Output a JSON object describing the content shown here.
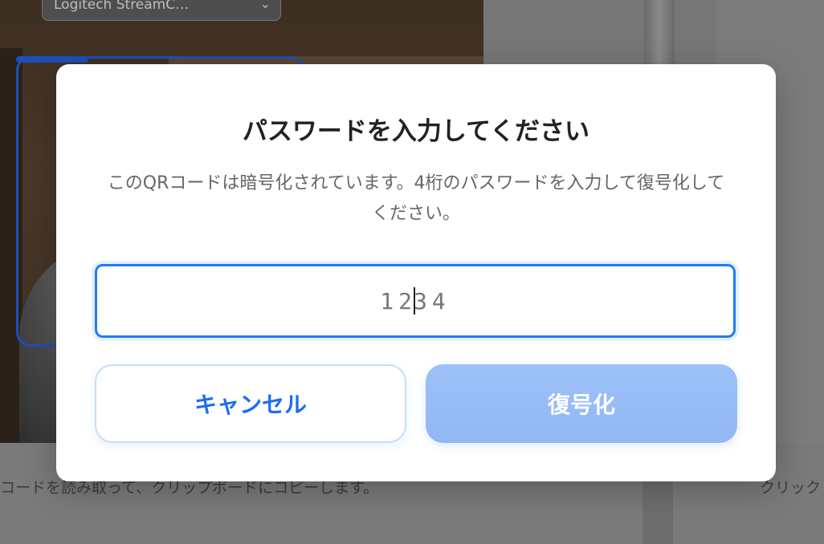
{
  "background": {
    "camera_select_label": "Logitech StreamC…",
    "footer_text_left": "コードを読み取って、クリップボードにコピーします。",
    "footer_text_right": "クリック"
  },
  "dialog": {
    "title": "パスワードを入力してください",
    "description": "このQRコードは暗号化されています。4桁のパスワードを入力して復号化してください。",
    "password_value_before_caret": "12",
    "password_value_after_caret": "34",
    "cancel_label": "キャンセル",
    "decrypt_label": "復号化"
  },
  "colors": {
    "accent": "#1f7cf5",
    "decrypt_button": "#9cc0f8",
    "cancel_text": "#1d6df0"
  }
}
